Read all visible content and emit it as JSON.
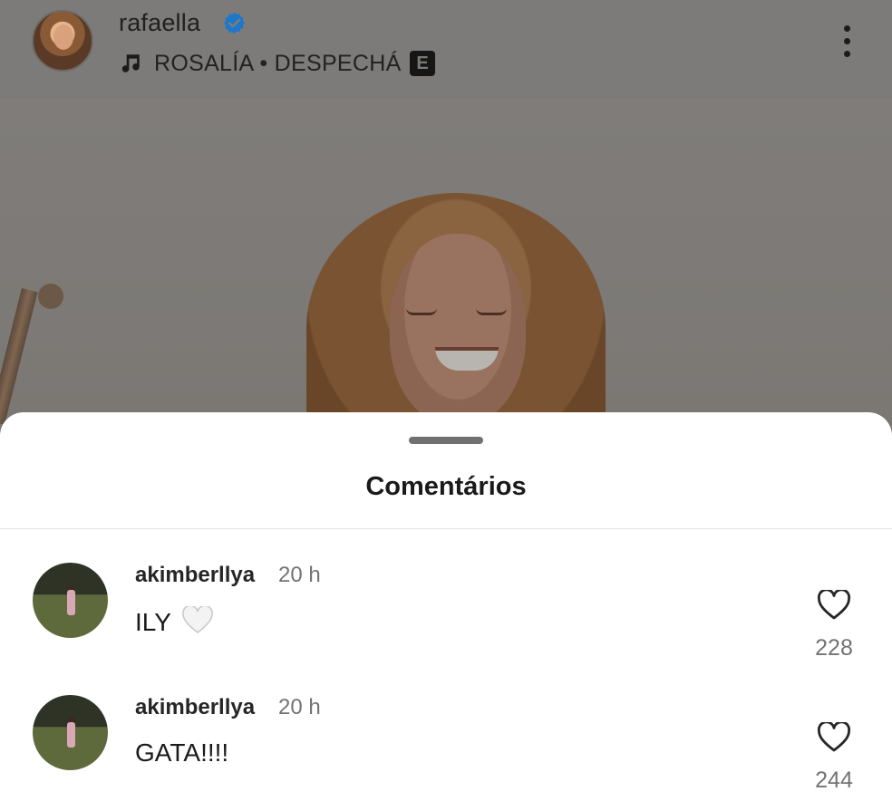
{
  "post": {
    "username": "rafaella",
    "verified": true,
    "song": "ROSALÍA • DESPECHÁ",
    "explicit_label": "E",
    "icons": {
      "verified": "verified-badge-icon",
      "music": "music-note-icon",
      "more": "more-options-icon"
    }
  },
  "comments_sheet": {
    "title": "Comentários",
    "comments": [
      {
        "username": "akimberllya",
        "time": "20 h",
        "text": "ILY",
        "emoji": "white-heart-icon",
        "likes": "228"
      },
      {
        "username": "akimberllya",
        "time": "20 h",
        "text": "GATA!!!!",
        "likes": "244"
      }
    ]
  },
  "colors": {
    "verified_blue": "#1f77c9",
    "sheet_bg": "#ffffff",
    "dim_overlay": "#7d7b79"
  }
}
